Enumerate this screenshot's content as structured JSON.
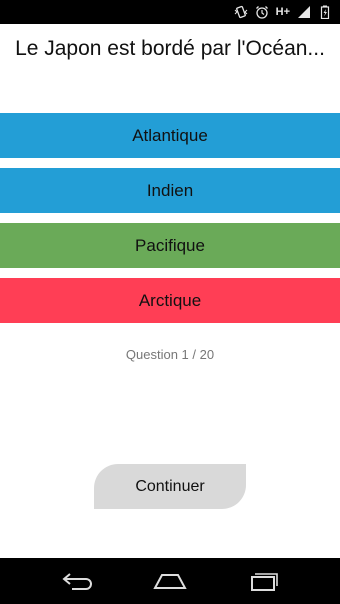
{
  "status_bar": {
    "network_label": "H+",
    "icons": [
      "vibrate-icon",
      "alarm-icon",
      "signal-icon",
      "battery-icon"
    ]
  },
  "question": {
    "text": "Le Japon est bordé par l'Océan..."
  },
  "answers": [
    {
      "label": "Atlantique",
      "color": "#239ed6"
    },
    {
      "label": "Indien",
      "color": "#239ed6"
    },
    {
      "label": "Pacifique",
      "color": "#6aaa58"
    },
    {
      "label": "Arctique",
      "color": "#ff3e55"
    }
  ],
  "progress": {
    "text": "Question 1 / 20",
    "current": 1,
    "total": 20
  },
  "actions": {
    "continue_label": "Continuer"
  },
  "nav_bar": {
    "icons": [
      "back-icon",
      "home-icon",
      "recent-apps-icon"
    ]
  }
}
